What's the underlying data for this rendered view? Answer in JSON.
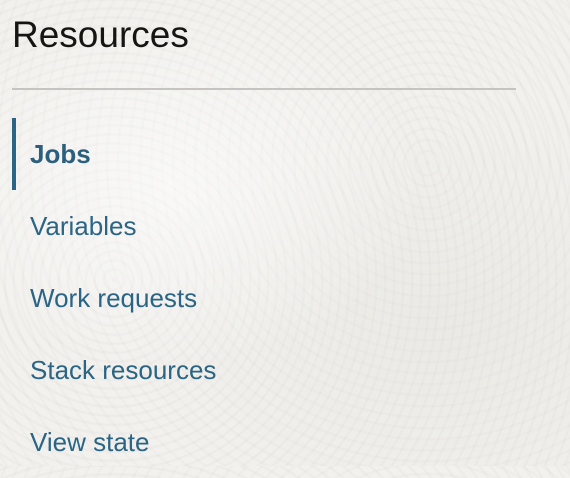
{
  "panel": {
    "title": "Resources"
  },
  "nav": {
    "items": [
      {
        "label": "Jobs",
        "active": true
      },
      {
        "label": "Variables",
        "active": false
      },
      {
        "label": "Work requests",
        "active": false
      },
      {
        "label": "Stack resources",
        "active": false
      },
      {
        "label": "View state",
        "active": false
      }
    ]
  },
  "colors": {
    "accent": "#2b6585",
    "title_text": "#161513",
    "divider": "#c6c4c0",
    "background": "#f2f1ee"
  }
}
